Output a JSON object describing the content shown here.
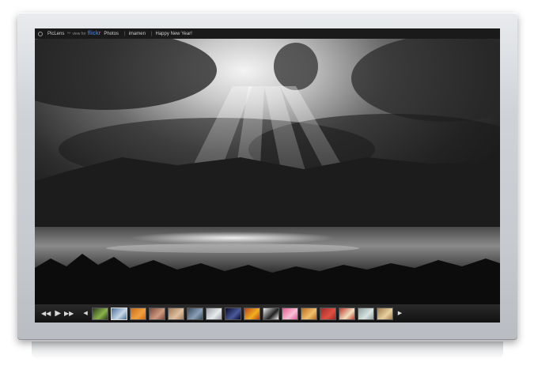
{
  "titlebar": {
    "app_name": "PicLens",
    "tm": "™",
    "view_for": "view for",
    "flickr_a": "flick",
    "flickr_b": "r",
    "section": "Photos",
    "user": "imamen",
    "photo_title": "Happy New Year!"
  },
  "player": {
    "rewind_icon": "double-left-arrow",
    "play_icon": "play-triangle",
    "forward_icon": "double-right-arrow",
    "prev_icon": "left-arrow",
    "next_icon": "right-arrow"
  },
  "thumbnails": [
    {
      "colors": [
        "#2a3a1a",
        "#8ab34a"
      ]
    },
    {
      "colors": [
        "#4a6f9a",
        "#c8d8e8"
      ],
      "selected": true
    },
    {
      "colors": [
        "#c96a1a",
        "#f0a040"
      ]
    },
    {
      "colors": [
        "#7a4a3a",
        "#d09a80"
      ]
    },
    {
      "colors": [
        "#a07a5a",
        "#e0c0a0"
      ]
    },
    {
      "colors": [
        "#3a4a5a",
        "#8aa0b8"
      ]
    },
    {
      "colors": [
        "#9aa0a8",
        "#e8eaec"
      ]
    },
    {
      "colors": [
        "#0a0a2a",
        "#4a5a9a"
      ]
    },
    {
      "colors": [
        "#b8401a",
        "#f0b020"
      ]
    },
    {
      "colors": [
        "#f0f0f0",
        "#202020"
      ]
    },
    {
      "colors": [
        "#e05a90",
        "#f8c0d8"
      ]
    },
    {
      "colors": [
        "#b86a1a",
        "#f0c070"
      ]
    },
    {
      "colors": [
        "#9a2a2a",
        "#e05040"
      ]
    },
    {
      "colors": [
        "#c03a2a",
        "#f0e0c0"
      ]
    },
    {
      "colors": [
        "#8aa0a0",
        "#d8e4e0"
      ]
    },
    {
      "colors": [
        "#a07a4a",
        "#e8d0a0"
      ]
    }
  ]
}
